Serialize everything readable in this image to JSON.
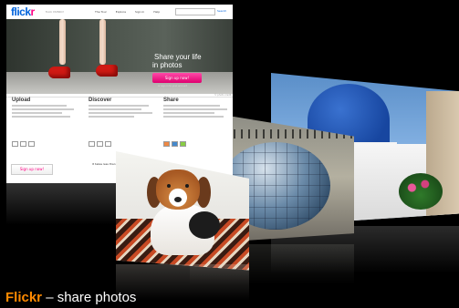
{
  "colors": {
    "brand_orange": "#ff8a00",
    "flickr_blue": "#0063dc",
    "flickr_pink": "#ff0084"
  },
  "flickr_page": {
    "logo_text_blue": "flick",
    "logo_text_pink": "r",
    "yahoo_text": "from YAHOO!",
    "nav": [
      "The Tour",
      "Explore",
      "Sign In",
      "Help"
    ],
    "search_label": "Search",
    "hero_line1": "Share your life",
    "hero_line2": "in photos",
    "signup_label": "Sign up now!",
    "signup_hint": "or sign in to your account",
    "photo_credit": "© photo credit",
    "columns": [
      {
        "title": "Upload",
        "icon": "upload-icon"
      },
      {
        "title": "Discover",
        "icon": "discover-icon"
      },
      {
        "title": "Share",
        "icon": "share-icon"
      }
    ],
    "signup2_label": "Sign up now!",
    "bottom_text": "It takes less than a minute"
  },
  "caption": {
    "brand": "Flickr",
    "rest": " – share photos"
  }
}
